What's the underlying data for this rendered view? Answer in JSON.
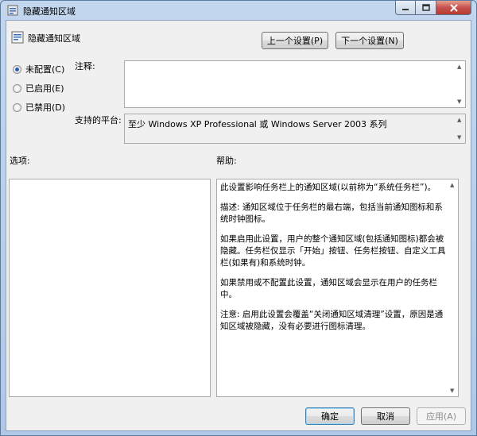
{
  "window": {
    "title": "隐藏通知区域"
  },
  "header": {
    "title": "隐藏通知区域"
  },
  "nav": {
    "prev_label": "上一个设置(P)",
    "next_label": "下一个设置(N)"
  },
  "state": {
    "options": [
      {
        "label": "未配置(C)",
        "checked": true
      },
      {
        "label": "已启用(E)",
        "checked": false
      },
      {
        "label": "已禁用(D)",
        "checked": false
      }
    ]
  },
  "comment": {
    "label": "注释:",
    "value": ""
  },
  "platform": {
    "label": "支持的平台:",
    "value": "至少 Windows XP Professional 或 Windows Server 2003 系列"
  },
  "options_section": {
    "label": "选项:"
  },
  "help_section": {
    "label": "帮助:",
    "paragraphs": [
      "此设置影响任务栏上的通知区域(以前称为“系统任务栏”)。",
      "描述: 通知区域位于任务栏的最右端，包括当前通知图标和系统时钟图标。",
      "如果启用此设置，用户的整个通知区域(包括通知图标)都会被隐藏。任务栏仅显示「开始」按钮、任务栏按钮、自定义工具栏(如果有)和系统时钟。",
      "如果禁用或不配置此设置，通知区域会显示在用户的任务栏中。",
      "注意: 启用此设置会覆盖“关闭通知区域清理”设置，原因是通知区域被隐藏，没有必要进行图标清理。"
    ]
  },
  "footer": {
    "ok_label": "确定",
    "cancel_label": "取消",
    "apply_label": "应用(A)"
  },
  "colors": {
    "accent": "#2a5cb8",
    "close_button": "#c75050"
  }
}
